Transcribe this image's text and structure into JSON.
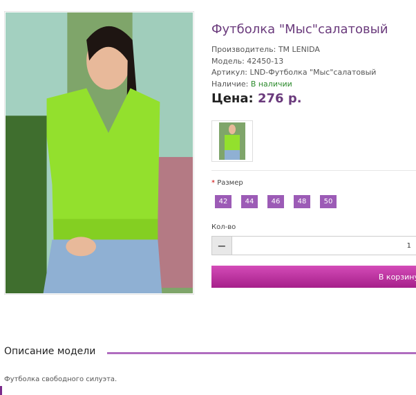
{
  "product": {
    "title": "Футболка \"Мыс\"салатовый",
    "manufacturer": "Производитель: TM LENIDA",
    "model": "Модель: 42450-13",
    "sku": "Артикул: LND-Футболка \"Мыс\"салатовый",
    "availability_label": "Наличие: ",
    "availability_value": "В наличии",
    "price_label": "Цена:",
    "price_value": "276 р."
  },
  "options": {
    "size_required_mark": "*",
    "size_label": "Размер",
    "sizes": [
      "42",
      "44",
      "46",
      "48",
      "50"
    ],
    "qty_label": "Кол-во",
    "qty_minus": "−",
    "qty_value": "1"
  },
  "cart": {
    "label": "В корзину"
  },
  "description": {
    "heading": "Описание модели",
    "text": "Футболка свободного силуэта."
  },
  "colors": {
    "accent": "#6a3a7c",
    "size_button": "#9c5bb6",
    "cart": "#c0369f",
    "available": "#2b8a2b"
  },
  "icons": {
    "main_image": "product-photo",
    "thumbnail": "product-thumbnail"
  }
}
